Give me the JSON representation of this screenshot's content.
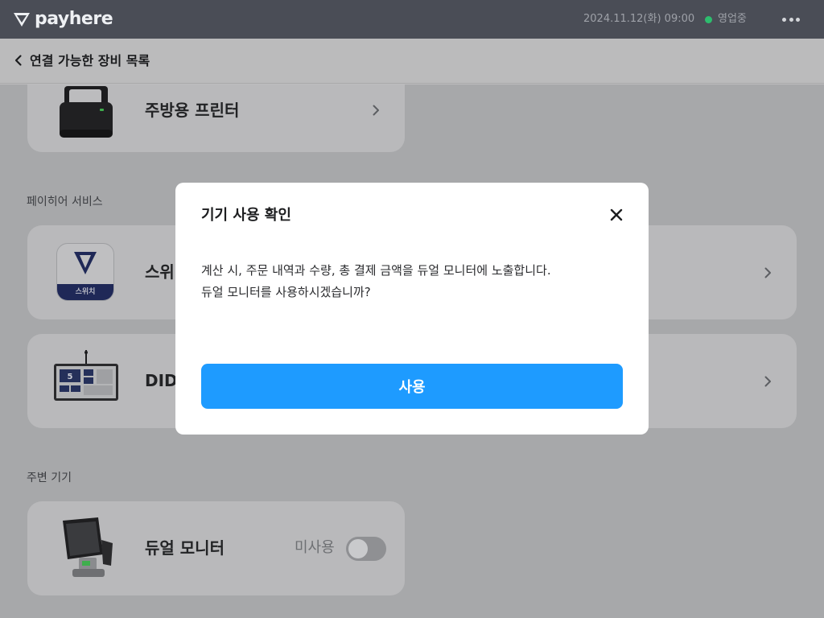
{
  "topbar": {
    "brand": "payhere",
    "datetime": "2024.11.12(화) 09:00",
    "status": "영업중",
    "icons": {
      "logo": "payhere-logo-icon",
      "status": "status-dot-icon",
      "more": "more-dots-icon"
    }
  },
  "header": {
    "title": "연결 가능한 장비 목록",
    "back_icon": "chevron-left-icon"
  },
  "devices": {
    "kitchen_printer": {
      "title": "주방용 프린터"
    },
    "section_payhere": "페이히어 서비스",
    "switch": {
      "title": "스위",
      "badge": "스위치"
    },
    "did": {
      "title": "DID",
      "screen_number": "5"
    },
    "section_peripheral": "주변 기기",
    "dual_monitor": {
      "title": "듀얼 모니터",
      "toggle_label": "미사용",
      "enabled": false
    }
  },
  "modal": {
    "title": "기기 사용 확인",
    "body_line1": "계산 시, 주문 내역과 수량, 총 결제 금액을 듀얼 모니터에 노출합니다.",
    "body_line2": "듀얼 모니터를 사용하시겠습니까?",
    "confirm_label": "사용",
    "close_icon": "close-icon"
  },
  "colors": {
    "topbar": "#4a4d56",
    "overlay_content": "#a7a8aa",
    "primary_button": "#1e9bff",
    "status_green": "#2dbd6e",
    "switch_badge": "#1f2857"
  }
}
